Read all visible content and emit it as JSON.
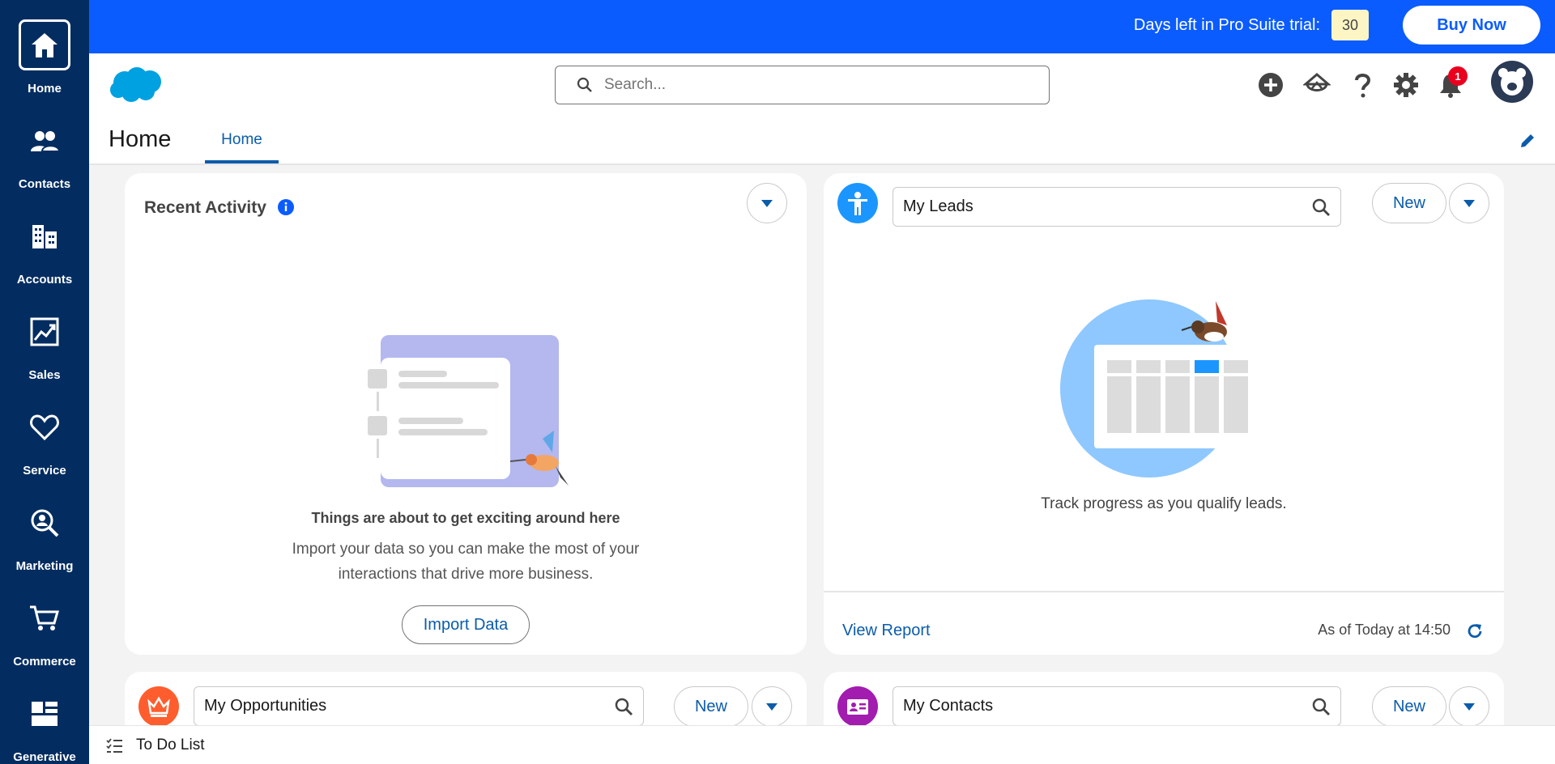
{
  "nav": {
    "items": [
      {
        "label": "Home",
        "icon": "home-icon"
      },
      {
        "label": "Contacts",
        "icon": "contacts-icon"
      },
      {
        "label": "Accounts",
        "icon": "accounts-icon"
      },
      {
        "label": "Sales",
        "icon": "sales-icon"
      },
      {
        "label": "Service",
        "icon": "service-icon"
      },
      {
        "label": "Marketing",
        "icon": "marketing-icon"
      },
      {
        "label": "Commerce",
        "icon": "commerce-icon"
      },
      {
        "label": "Generative",
        "icon": "generative-icon"
      }
    ]
  },
  "banner": {
    "trial_text": "Days left in Pro Suite trial:",
    "days_left": "30",
    "buy_label": "Buy Now"
  },
  "header": {
    "search_placeholder": "Search...",
    "notification_count": "1"
  },
  "tabs": {
    "app_name": "Home",
    "active_tab": "Home"
  },
  "recent_activity": {
    "title": "Recent Activity",
    "empty_title": "Things are about to get exciting around here",
    "empty_line1": "Import your data so you can make the most of your",
    "empty_line2": "interactions that drive more business.",
    "import_label": "Import Data"
  },
  "leads": {
    "list_name": "My Leads",
    "new_label": "New",
    "empty_text": "Track progress as you qualify leads.",
    "view_report": "View Report",
    "as_of": "As of Today at 14:50"
  },
  "opportunities": {
    "list_name": "My Opportunities",
    "new_label": "New"
  },
  "contacts": {
    "list_name": "My Contacts",
    "new_label": "New"
  },
  "utility": {
    "todo_label": "To Do List"
  },
  "colors": {
    "nav_bg": "#032d60",
    "banner_bg": "#0b5cff",
    "brand_link": "#0b5cab",
    "leads_icon": "#1b96ff",
    "opportunities_icon": "#ff5d2d",
    "contacts_icon": "#a21caf"
  }
}
